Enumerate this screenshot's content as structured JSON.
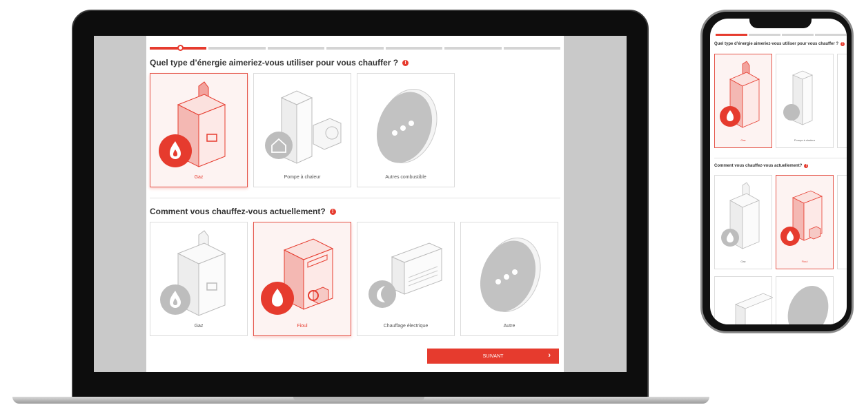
{
  "step_index": 1,
  "step_count": 7,
  "question1": {
    "title": "Quel type d’énergie aimeriez-vous utiliser pour vous chauffer ?",
    "options": [
      {
        "label": "Gaz",
        "icon": "gas-boiler-icon",
        "selected": true
      },
      {
        "label": "Pompe à chaleur",
        "icon": "heat-pump-icon",
        "selected": false
      },
      {
        "label": "Autres combustible",
        "icon": "more-options-icon",
        "selected": false
      }
    ]
  },
  "question2": {
    "title": "Comment vous chauffez-vous actuellement?",
    "options": [
      {
        "label": "Gaz",
        "icon": "gas-boiler-icon",
        "selected": false
      },
      {
        "label": "Fioul",
        "icon": "oil-boiler-icon",
        "selected": true
      },
      {
        "label": "Chauffage électrique",
        "icon": "electric-heater-icon",
        "selected": false
      },
      {
        "label": "Autre",
        "icon": "more-options-icon",
        "selected": false
      }
    ]
  },
  "next_button": {
    "label": "SUIVANT",
    "icon": "chevron-right-icon"
  },
  "info_icon": "info-icon",
  "colors": {
    "accent": "#e63b2e",
    "selected_bg": "#fdf3f2",
    "icon_gray": "#b9b9b9",
    "border": "#dcdcdc"
  }
}
